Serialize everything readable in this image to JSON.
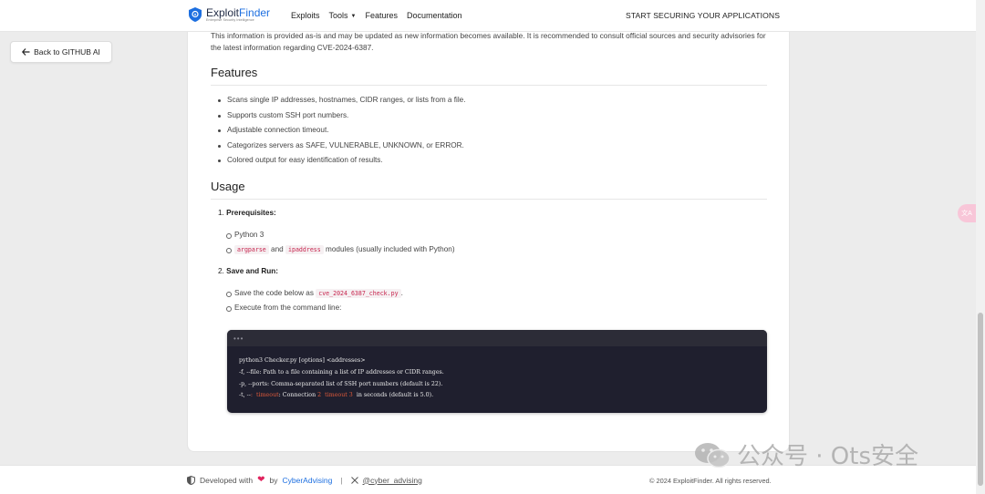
{
  "header": {
    "logo_main": "Exploit",
    "logo_accent": "Finder",
    "logo_sub": "Enterprise Security Intelligence",
    "nav": [
      "Exploits",
      "Tools",
      "Features",
      "Documentation"
    ],
    "cta": "START SECURING YOUR APPLICATIONS"
  },
  "back_button": "Back to GITHUB AI",
  "intro_text": "This information is provided as-is and may be updated as new information becomes available. It is recommended to consult official sources and security advisories for the latest information regarding CVE-2024-6387.",
  "features": {
    "heading": "Features",
    "items": [
      "Scans single IP addresses, hostnames, CIDR ranges, or lists from a file.",
      "Supports custom SSH port numbers.",
      "Adjustable connection timeout.",
      "Categorizes servers as SAFE, VULNERABLE, UNKNOWN, or ERROR.",
      "Colored output for easy identification of results."
    ]
  },
  "usage": {
    "heading": "Usage",
    "step1_num": "1.",
    "step1_label": "Prerequisites:",
    "python": "Python 3",
    "mod_a": "argparse",
    "and": "and",
    "mod_b": "ipaddress",
    "modules_text": "modules (usually included with Python)",
    "step2_num": "2.",
    "step2_label": "Save and Run:",
    "save_prefix": "Save the code below as",
    "save_file": "cve_2024_6387_check.py",
    "save_suffix": ".",
    "execute": "Execute from the command line:"
  },
  "terminal": {
    "dots": "•••",
    "line1": "python3 Checker.py [options] <addresses>",
    "line2": "-f, --file: Path to a file containing a list of IP addresses or CIDR ranges.",
    "line3": "-p, --ports: Comma-separated list of SSH port numbers (default is 22).",
    "line4_a": "-t, --",
    "line4_b": ":  timeout",
    "line4_c": ": Connection ",
    "line4_d": "2  timeout 3",
    "line4_e": "  in seconds (default is 5.0)."
  },
  "footer": {
    "developed": "Developed with",
    "by": "by",
    "company": "CyberAdvising",
    "separator": "|",
    "handle": "@cyber_advising",
    "copyright": "© 2024 ExploitFinder. All rights reserved."
  },
  "watermark": "公众号 · Ots安全",
  "float_button": "文A",
  "colors": {
    "accent": "#1d6fe0",
    "code_pink": "#c7254e",
    "terminal_bg": "#1f1f2e",
    "heart": "#e0245e"
  }
}
